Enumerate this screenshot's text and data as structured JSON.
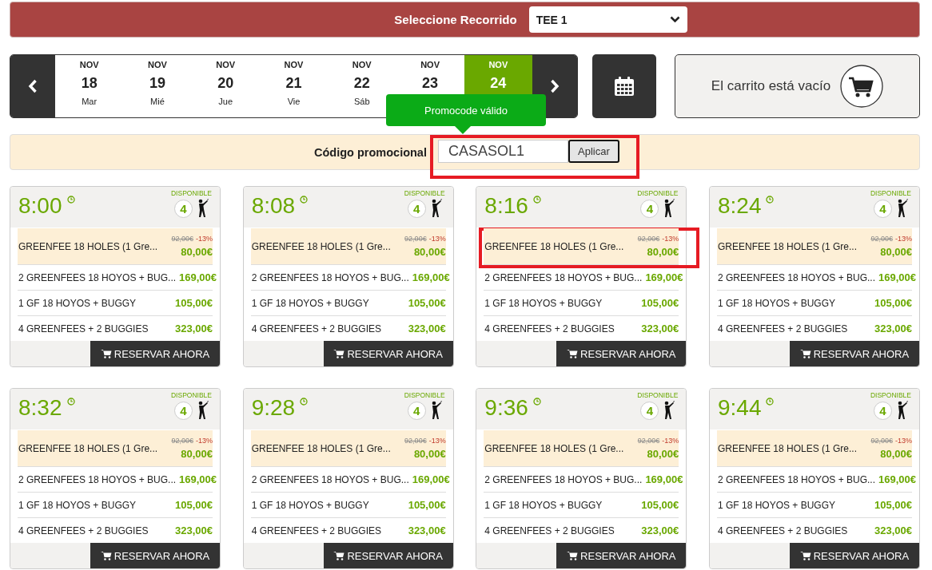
{
  "course_selector": {
    "label": "Seleccione Recorrido",
    "value": "TEE 1"
  },
  "dates": [
    {
      "month": "NOV",
      "day": "18",
      "weekday": "Mar",
      "selected": false
    },
    {
      "month": "NOV",
      "day": "19",
      "weekday": "Mié",
      "selected": false
    },
    {
      "month": "NOV",
      "day": "20",
      "weekday": "Jue",
      "selected": false
    },
    {
      "month": "NOV",
      "day": "21",
      "weekday": "Vie",
      "selected": false
    },
    {
      "month": "NOV",
      "day": "22",
      "weekday": "Sáb",
      "selected": false
    },
    {
      "month": "NOV",
      "day": "23",
      "selected": false
    },
    {
      "month": "NOV",
      "day": "24",
      "selected": true
    }
  ],
  "cart": {
    "text": "El carrito está vacío"
  },
  "promo": {
    "label": "Código promocional",
    "value": "CASASOL1",
    "button": "Aplicar",
    "tooltip": "Promocode válido",
    "highlighted": true
  },
  "tee_times": [
    {
      "time": "8:00",
      "availability_label": "DISPONIBLE",
      "players": "4",
      "rows": [
        {
          "name": "GREENFEE 18 HOLES (1 Gre...",
          "old_price": "92,00€",
          "discount": "-13%",
          "price": "80,00€",
          "discounted": true,
          "highlighted": false
        },
        {
          "name": "2 GREENFEES 18 HOYOS + BUG...",
          "price": "169,00€",
          "discounted": false,
          "highlighted": false
        },
        {
          "name": "1 GF 18 HOYOS + BUGGY",
          "price": "105,00€",
          "discounted": false,
          "highlighted": false
        },
        {
          "name": "4 GREENFEES + 2 BUGGIES",
          "price": "323,00€",
          "discounted": false,
          "highlighted": false
        }
      ],
      "button": "RESERVAR AHORA"
    },
    {
      "time": "8:08",
      "availability_label": "DISPONIBLE",
      "players": "4",
      "rows": [
        {
          "name": "GREENFEE 18 HOLES (1 Gre...",
          "old_price": "92,00€",
          "discount": "-13%",
          "price": "80,00€",
          "discounted": true,
          "highlighted": false
        },
        {
          "name": "2 GREENFEES 18 HOYOS + BUG...",
          "price": "169,00€",
          "discounted": false,
          "highlighted": false
        },
        {
          "name": "1 GF 18 HOYOS + BUGGY",
          "price": "105,00€",
          "discounted": false,
          "highlighted": false
        },
        {
          "name": "4 GREENFEES + 2 BUGGIES",
          "price": "323,00€",
          "discounted": false,
          "highlighted": false
        }
      ],
      "button": "RESERVAR AHORA"
    },
    {
      "time": "8:16",
      "availability_label": "DISPONIBLE",
      "players": "4",
      "rows": [
        {
          "name": "GREENFEE 18 HOLES (1 Gre...",
          "old_price": "92,00€",
          "discount": "-13%",
          "price": "80,00€",
          "discounted": true,
          "highlighted": true
        },
        {
          "name": "2 GREENFEES 18 HOYOS + BUG...",
          "price": "169,00€",
          "discounted": false,
          "highlighted": false
        },
        {
          "name": "1 GF 18 HOYOS + BUGGY",
          "price": "105,00€",
          "discounted": false,
          "highlighted": false
        },
        {
          "name": "4 GREENFEES + 2 BUGGIES",
          "price": "323,00€",
          "discounted": false,
          "highlighted": false
        }
      ],
      "button": "RESERVAR AHORA"
    },
    {
      "time": "8:24",
      "availability_label": "DISPONIBLE",
      "players": "4",
      "rows": [
        {
          "name": "GREENFEE 18 HOLES (1 Gre...",
          "old_price": "92,00€",
          "discount": "-13%",
          "price": "80,00€",
          "discounted": true,
          "highlighted": false
        },
        {
          "name": "2 GREENFEES 18 HOYOS + BUG...",
          "price": "169,00€",
          "discounted": false,
          "highlighted": false
        },
        {
          "name": "1 GF 18 HOYOS + BUGGY",
          "price": "105,00€",
          "discounted": false,
          "highlighted": false
        },
        {
          "name": "4 GREENFEES + 2 BUGGIES",
          "price": "323,00€",
          "discounted": false,
          "highlighted": false
        }
      ],
      "button": "RESERVAR AHORA"
    },
    {
      "time": "8:32",
      "availability_label": "DISPONIBLE",
      "players": "4",
      "rows": [
        {
          "name": "GREENFEE 18 HOLES (1 Gre...",
          "old_price": "92,00€",
          "discount": "-13%",
          "price": "80,00€",
          "discounted": true,
          "highlighted": false
        },
        {
          "name": "2 GREENFEES 18 HOYOS + BUG...",
          "price": "169,00€",
          "discounted": false,
          "highlighted": false
        },
        {
          "name": "1 GF 18 HOYOS + BUGGY",
          "price": "105,00€",
          "discounted": false,
          "highlighted": false
        },
        {
          "name": "4 GREENFEES + 2 BUGGIES",
          "price": "323,00€",
          "discounted": false,
          "highlighted": false
        }
      ],
      "button": "RESERVAR AHORA"
    },
    {
      "time": "9:28",
      "availability_label": "DISPONIBLE",
      "players": "4",
      "rows": [
        {
          "name": "GREENFEE 18 HOLES (1 Gre...",
          "old_price": "92,00€",
          "discount": "-13%",
          "price": "80,00€",
          "discounted": true,
          "highlighted": false
        },
        {
          "name": "2 GREENFEES 18 HOYOS + BUG...",
          "price": "169,00€",
          "discounted": false,
          "highlighted": false
        },
        {
          "name": "1 GF 18 HOYOS + BUGGY",
          "price": "105,00€",
          "discounted": false,
          "highlighted": false
        },
        {
          "name": "4 GREENFEES + 2 BUGGIES",
          "price": "323,00€",
          "discounted": false,
          "highlighted": false
        }
      ],
      "button": "RESERVAR AHORA"
    },
    {
      "time": "9:36",
      "availability_label": "DISPONIBLE",
      "players": "4",
      "rows": [
        {
          "name": "GREENFEE 18 HOLES (1 Gre...",
          "old_price": "92,00€",
          "discount": "-13%",
          "price": "80,00€",
          "discounted": true,
          "highlighted": false
        },
        {
          "name": "2 GREENFEES 18 HOYOS + BUG...",
          "price": "169,00€",
          "discounted": false,
          "highlighted": false
        },
        {
          "name": "1 GF 18 HOYOS + BUGGY",
          "price": "105,00€",
          "discounted": false,
          "highlighted": false
        },
        {
          "name": "4 GREENFEES + 2 BUGGIES",
          "price": "323,00€",
          "discounted": false,
          "highlighted": false
        }
      ],
      "button": "RESERVAR AHORA"
    },
    {
      "time": "9:44",
      "availability_label": "DISPONIBLE",
      "players": "4",
      "rows": [
        {
          "name": "GREENFEE 18 HOLES (1 Gre...",
          "old_price": "92,00€",
          "discount": "-13%",
          "price": "80,00€",
          "discounted": true,
          "highlighted": false
        },
        {
          "name": "2 GREENFEES 18 HOYOS + BUG...",
          "price": "169,00€",
          "discounted": false,
          "highlighted": false
        },
        {
          "name": "1 GF 18 HOYOS + BUGGY",
          "price": "105,00€",
          "discounted": false,
          "highlighted": false
        },
        {
          "name": "4 GREENFEES + 2 BUGGIES",
          "price": "323,00€",
          "discounted": false,
          "highlighted": false
        }
      ],
      "button": "RESERVAR AHORA"
    }
  ]
}
